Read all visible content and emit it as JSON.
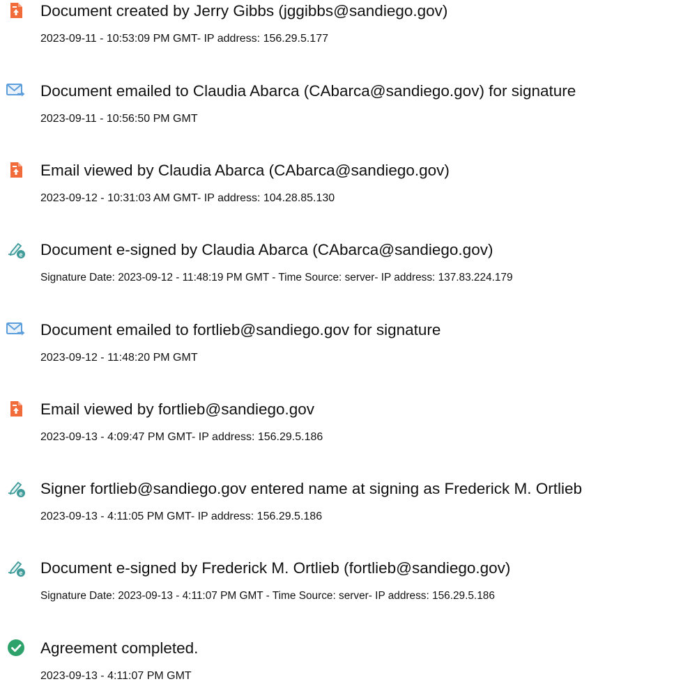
{
  "colors": {
    "doc_icon": "#F26B3A",
    "email_icon": "#5C9DDB",
    "esign_icon": "#3F9C9A",
    "completed_icon": "#2DA36B"
  },
  "events": [
    {
      "icon": "document-icon",
      "title": "Document created by Jerry Gibbs (jggibbs@sandiego.gov)",
      "detail": "2023-09-11 - 10:53:09 PM GMT- IP address: 156.29.5.177"
    },
    {
      "icon": "email-icon",
      "title": "Document emailed to Claudia Abarca (CAbarca@sandiego.gov) for signature",
      "detail": "2023-09-11 - 10:56:50 PM GMT"
    },
    {
      "icon": "document-icon",
      "title": "Email viewed by Claudia Abarca (CAbarca@sandiego.gov)",
      "detail": "2023-09-12 - 10:31:03 AM GMT- IP address: 104.28.85.130"
    },
    {
      "icon": "esign-icon",
      "title": "Document e-signed by Claudia Abarca (CAbarca@sandiego.gov)",
      "detail": "Signature Date: 2023-09-12 - 11:48:19 PM GMT - Time Source: server- IP address: 137.83.224.179"
    },
    {
      "icon": "email-icon",
      "title": "Document emailed to fortlieb@sandiego.gov for signature",
      "detail": "2023-09-12 - 11:48:20 PM GMT"
    },
    {
      "icon": "document-icon",
      "title": "Email viewed by fortlieb@sandiego.gov",
      "detail": "2023-09-13 - 4:09:47 PM GMT- IP address: 156.29.5.186"
    },
    {
      "icon": "esign-icon",
      "title": "Signer fortlieb@sandiego.gov entered name at signing as Frederick M. Ortlieb",
      "detail": "2023-09-13 - 4:11:05 PM GMT- IP address: 156.29.5.186"
    },
    {
      "icon": "esign-icon",
      "title": "Document e-signed by Frederick M. Ortlieb (fortlieb@sandiego.gov)",
      "detail": "Signature Date: 2023-09-13 - 4:11:07 PM GMT - Time Source: server- IP address: 156.29.5.186"
    },
    {
      "icon": "checkmark-circle-icon",
      "title": "Agreement completed.",
      "detail": "2023-09-13 - 4:11:07 PM GMT"
    }
  ]
}
